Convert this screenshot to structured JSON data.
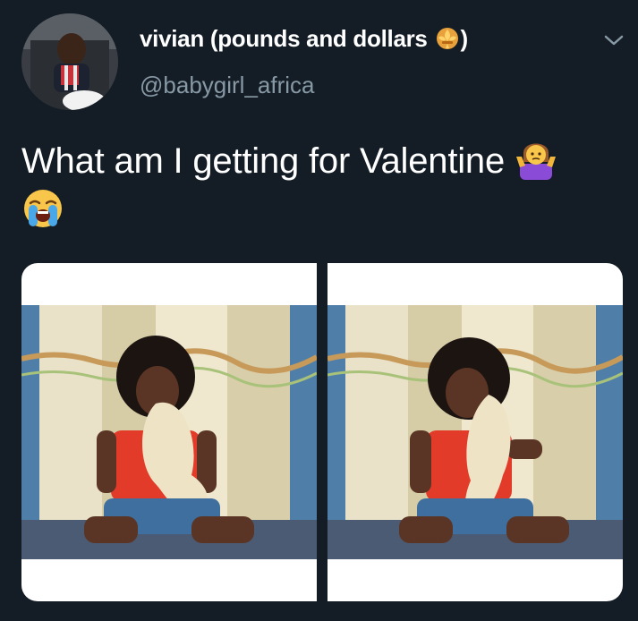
{
  "user": {
    "display_name": "vivian (pounds and dollars ",
    "display_name_suffix": ")",
    "handle": "@babygirl_africa",
    "avatar_icon": "profile-photo"
  },
  "tweet": {
    "text": "What am I getting for Valentine ",
    "emojis": [
      "person-shrugging-emoji",
      "loudly-crying-face-emoji"
    ]
  },
  "media": {
    "photos": [
      {
        "icon": "photo-woman-hugging-plush"
      },
      {
        "icon": "photo-woman-hugging-plush"
      }
    ]
  },
  "colors": {
    "background": "#141d26",
    "secondary_text": "#8899a6",
    "primary_text": "#ffffff"
  }
}
